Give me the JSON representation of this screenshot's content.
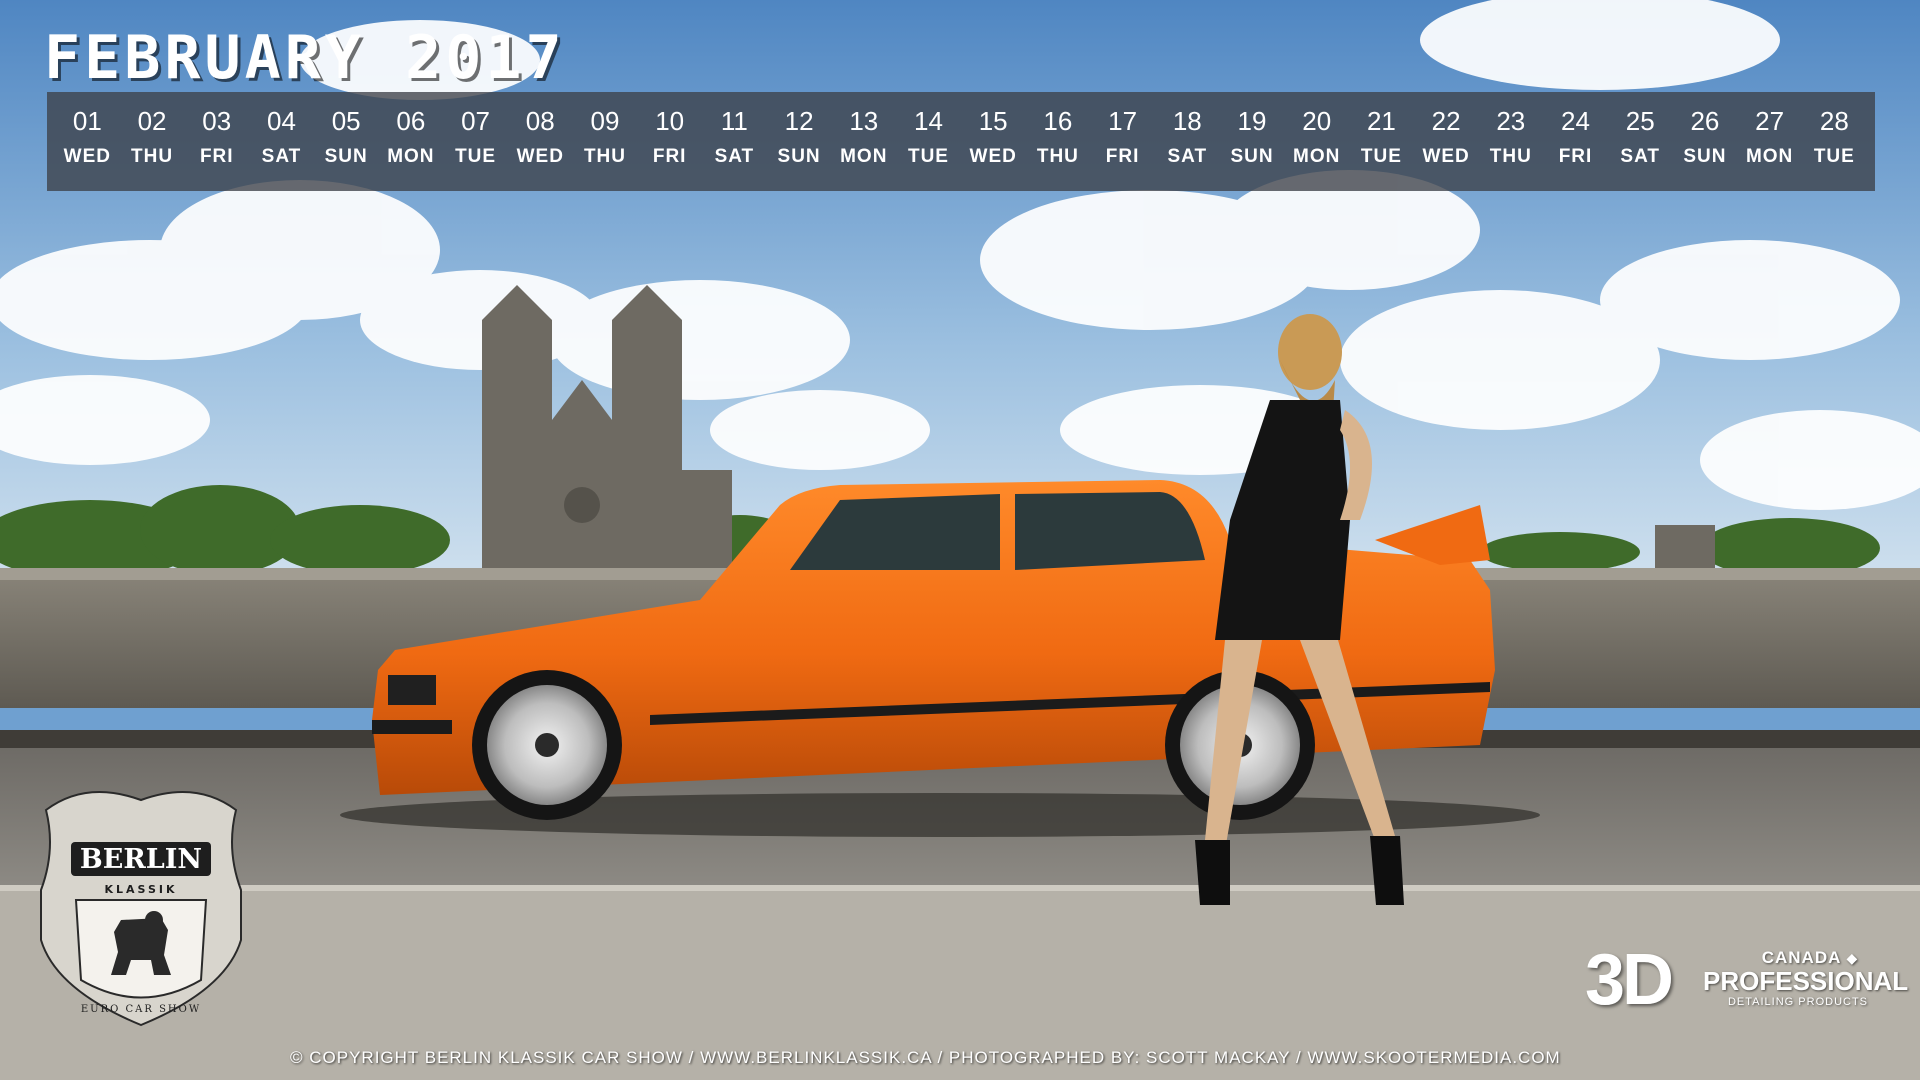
{
  "calendar": {
    "title": "FEBRUARY 2017",
    "days": [
      {
        "num": "01",
        "name": "WED"
      },
      {
        "num": "02",
        "name": "THU"
      },
      {
        "num": "03",
        "name": "FRI"
      },
      {
        "num": "04",
        "name": "SAT"
      },
      {
        "num": "05",
        "name": "SUN"
      },
      {
        "num": "06",
        "name": "MON"
      },
      {
        "num": "07",
        "name": "TUE"
      },
      {
        "num": "08",
        "name": "WED"
      },
      {
        "num": "09",
        "name": "THU"
      },
      {
        "num": "10",
        "name": "FRI"
      },
      {
        "num": "11",
        "name": "SAT"
      },
      {
        "num": "12",
        "name": "SUN"
      },
      {
        "num": "13",
        "name": "MON"
      },
      {
        "num": "14",
        "name": "TUE"
      },
      {
        "num": "15",
        "name": "WED"
      },
      {
        "num": "16",
        "name": "THU"
      },
      {
        "num": "17",
        "name": "FRI"
      },
      {
        "num": "18",
        "name": "SAT"
      },
      {
        "num": "19",
        "name": "SUN"
      },
      {
        "num": "20",
        "name": "MON"
      },
      {
        "num": "21",
        "name": "TUE"
      },
      {
        "num": "22",
        "name": "WED"
      },
      {
        "num": "23",
        "name": "THU"
      },
      {
        "num": "24",
        "name": "FRI"
      },
      {
        "num": "25",
        "name": "SAT"
      },
      {
        "num": "26",
        "name": "SUN"
      },
      {
        "num": "27",
        "name": "MON"
      },
      {
        "num": "28",
        "name": "TUE"
      }
    ]
  },
  "logos": {
    "berlin_name": "BERLIN",
    "berlin_sub": "KLASSIK",
    "berlin_tag": "EURO CAR SHOW",
    "pro_3d": "3D",
    "pro_country": "CANADA",
    "pro_word": "PROFESSIONAL",
    "pro_tagline": "DETAILING PRODUCTS"
  },
  "footer": {
    "copyright": "© COPYRIGHT BERLIN KLASSIK CAR SHOW / WWW.BERLINKLASSIK.CA / PHOTOGRAPHED BY: SCOTT MACKAY / WWW.SKOOTERMEDIA.COM"
  },
  "colors": {
    "car": "#f06a12",
    "sky": "#6fa0d0",
    "strip": "#3c4048"
  },
  "icons": [
    "bear-crest-icon",
    "maple-leaf-icon"
  ]
}
